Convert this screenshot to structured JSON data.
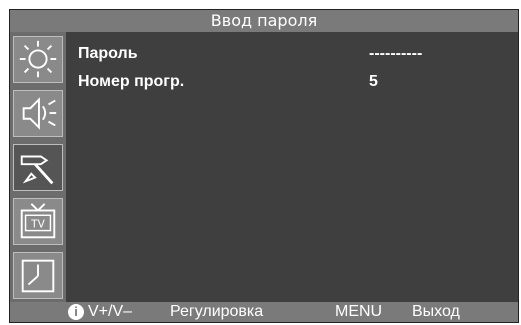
{
  "title": "Ввод пароля",
  "sidebar": {
    "items": [
      {
        "icon": "brightness-icon",
        "active": false
      },
      {
        "icon": "speaker-icon",
        "active": false
      },
      {
        "icon": "hammer-icon",
        "active": true
      },
      {
        "icon": "tv-icon",
        "active": false
      },
      {
        "icon": "clock-icon",
        "active": false
      }
    ]
  },
  "rows": [
    {
      "label": "Пароль",
      "value": "----------"
    },
    {
      "label": "Номер прогр.",
      "value": "5"
    }
  ],
  "footer": {
    "info_icon_glyph": "i",
    "volume_label": "V+/V–",
    "adjust_label": "Регулировка",
    "menu_label": "MENU",
    "exit_label": "Выход"
  }
}
